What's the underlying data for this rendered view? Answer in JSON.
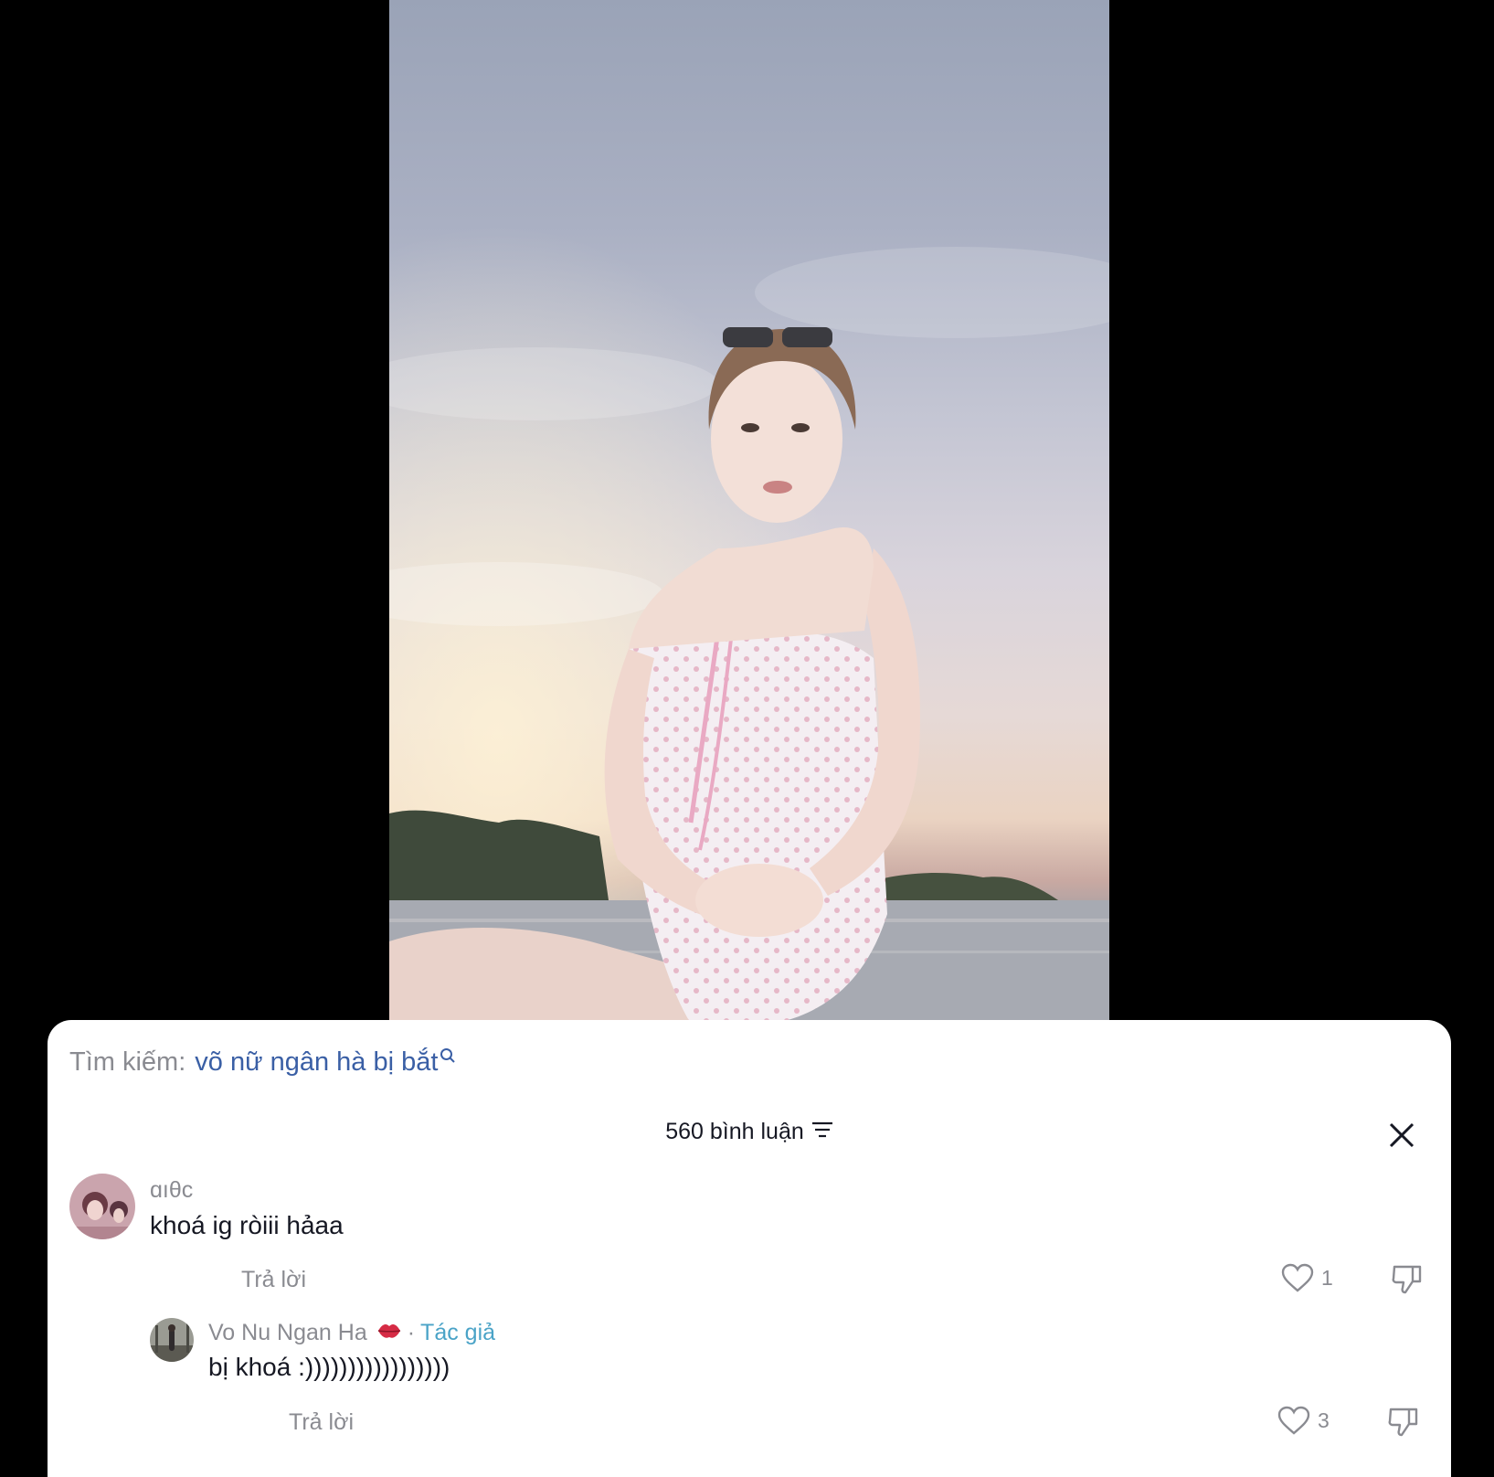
{
  "search": {
    "prefix": "Tìm kiếm:",
    "query": "võ nữ ngân hà bị bắt"
  },
  "comments_header": {
    "count_label": "560 bình luận"
  },
  "comments": [
    {
      "username": "ɑıθϲ",
      "text": "khoá ig ròiii hảaa",
      "reply_label": "Trả lời",
      "likes": "1"
    }
  ],
  "reply": {
    "username": "Vo Nu Ngan Ha",
    "separator": "·",
    "author_tag": "Tác giả",
    "text": "bị khoá :)))))))))))))))))",
    "reply_label": "Trả lời",
    "likes": "3"
  }
}
